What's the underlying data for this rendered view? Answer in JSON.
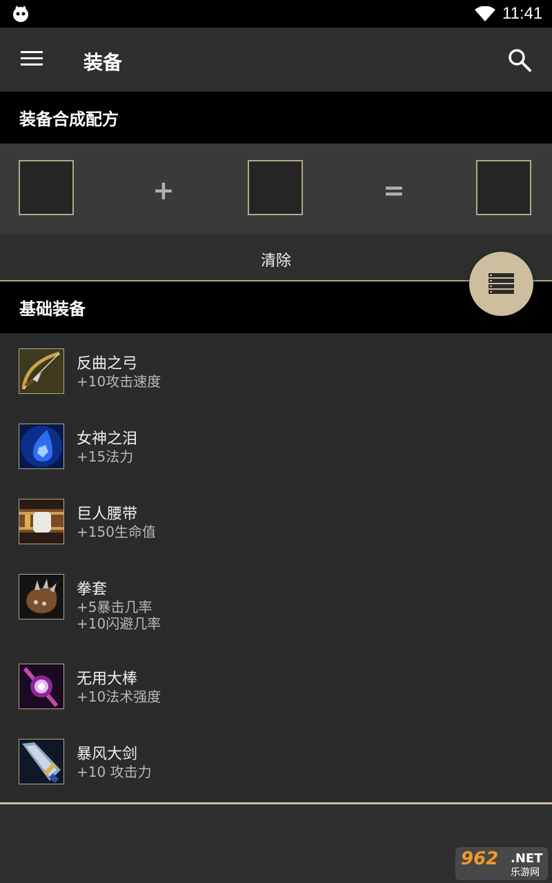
{
  "status_bar": {
    "time": "11:41",
    "left_icon": "notification-robot-icon",
    "wifi_icon": "wifi-icon"
  },
  "app_bar": {
    "title": "装备",
    "menu_icon": "menu-icon",
    "search_icon": "search-icon"
  },
  "recipe_section": {
    "header": "装备合成配方",
    "plus": "+",
    "equals": "=",
    "clear_label": "清除"
  },
  "fab": {
    "icon": "list-icon"
  },
  "basic_section": {
    "header": "基础装备",
    "items": [
      {
        "name": "反曲之弓",
        "stats": [
          "+10攻击速度"
        ],
        "icon": "recurve-bow-icon"
      },
      {
        "name": "女神之泪",
        "stats": [
          "+15法力"
        ],
        "icon": "tear-of-goddess-icon"
      },
      {
        "name": "巨人腰带",
        "stats": [
          "+150生命值"
        ],
        "icon": "giants-belt-icon"
      },
      {
        "name": "拳套",
        "stats": [
          "+5暴击几率",
          "+10闪避几率"
        ],
        "icon": "gloves-icon"
      },
      {
        "name": "无用大棒",
        "stats": [
          "+10法术强度"
        ],
        "icon": "large-rod-icon"
      },
      {
        "name": "暴风大剑",
        "stats": [
          "+10 攻击力"
        ],
        "icon": "bf-sword-icon"
      }
    ]
  },
  "watermark": {
    "big": "962",
    "net": ".NET",
    "sub": "乐游网"
  },
  "colors": {
    "accent": "#cdbf9e",
    "border": "#b5a88a",
    "header_bg": "#000000",
    "app_bar_bg": "#2f2f2f"
  }
}
